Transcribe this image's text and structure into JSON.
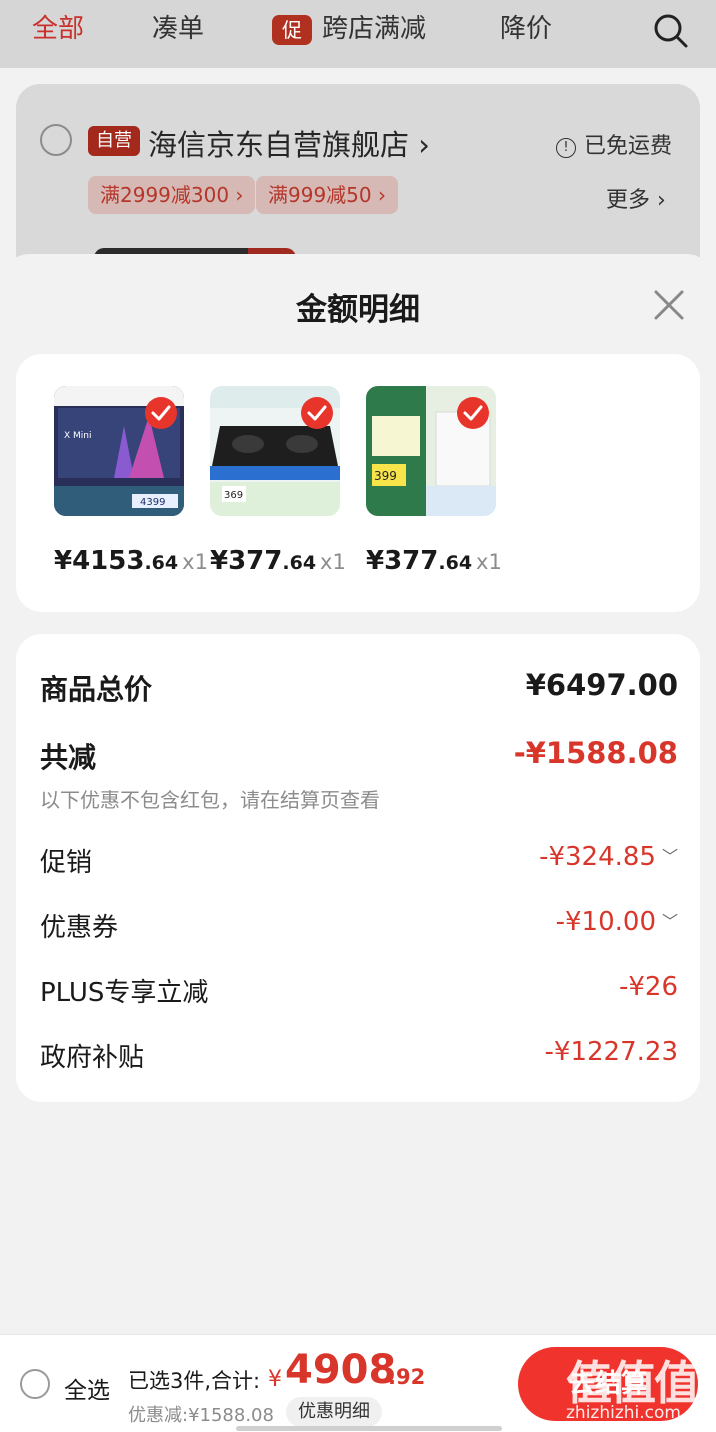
{
  "nav": {
    "tabs": [
      "全部",
      "凑单",
      "跨店满减",
      "降价"
    ],
    "promo_tag": "促"
  },
  "shop": {
    "self_tag": "自营",
    "name": "海信京东自营旗舰店",
    "shipping": "已免运费",
    "info_glyph": "!",
    "coupons": [
      "满2999减300",
      "满999减50"
    ],
    "more": "更多"
  },
  "sheet": {
    "title": "金额明细",
    "products": [
      {
        "price_int": "¥4153",
        "price_dec": ".64",
        "qty": "x1",
        "thumb_text": "X Mini",
        "thumb_price": "4399"
      },
      {
        "price_int": "¥377",
        "price_dec": ".64",
        "qty": "x1",
        "thumb_text": "",
        "thumb_price": "369"
      },
      {
        "price_int": "¥377",
        "price_dec": ".64",
        "qty": "x1",
        "thumb_text": "",
        "thumb_price": "399"
      }
    ],
    "summary": {
      "total_label": "商品总价",
      "total_value": "¥6497.00",
      "reduce_label": "共减",
      "reduce_value": "-¥1588.08",
      "note": "以下优惠不包含红包，请在结算页查看",
      "promo_label": "促销",
      "promo_value": "-¥324.85",
      "coupon_label": "优惠券",
      "coupon_value": "-¥10.00",
      "plus_label": "PLUS专享立减",
      "plus_value": "-¥26",
      "subsidy_label": "政府补贴",
      "subsidy_value": "-¥1227.23"
    }
  },
  "bottom": {
    "select_all": "全选",
    "selected_text": "已选3件,合计:",
    "currency": "¥",
    "total_int": "4908",
    "total_dec": ".92",
    "discount_text": "优惠减:¥1588.08",
    "detail_chip": "优惠明细",
    "checkout": "去结算",
    "watermark_logo": "值值值",
    "watermark_url": "zhizhizhi.com"
  },
  "colors": {
    "accent": "#d9362b",
    "checkout": "#f0342d",
    "self_tag": "#a3291c"
  }
}
